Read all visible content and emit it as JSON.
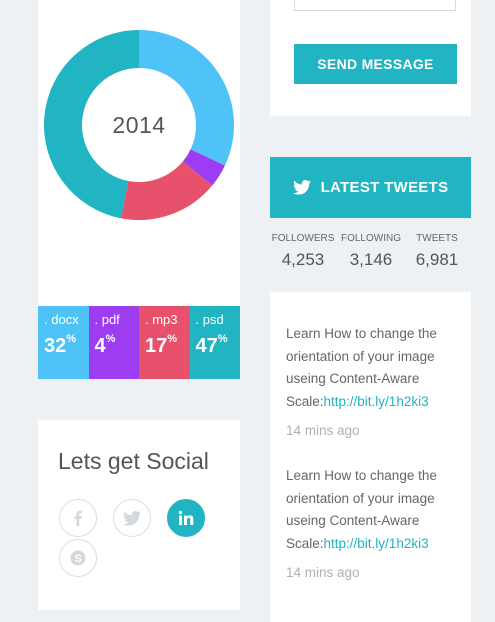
{
  "donut": {
    "center_label": "2014",
    "segments": [
      {
        "name": ".psd",
        "value": 47,
        "color": "#21b4c3"
      },
      {
        "name": ".mp3",
        "value": 17,
        "color": "#e8516b"
      },
      {
        "name": ".pdf",
        "value": 4,
        "color": "#9d3cf0"
      },
      {
        "name": ".docx",
        "value": 32,
        "color": "#4fc3f7"
      }
    ]
  },
  "stats": [
    {
      "ext": ". docx",
      "value": "32",
      "unit": "%",
      "color": "#4fc3f7"
    },
    {
      "ext": ". pdf",
      "value": "4",
      "unit": "%",
      "color": "#9d3cf0"
    },
    {
      "ext": ". mp3",
      "value": "17",
      "unit": "%",
      "color": "#e8516b"
    },
    {
      "ext": ". psd",
      "value": "47",
      "unit": "%",
      "color": "#21b4c3"
    }
  ],
  "social": {
    "title": "Lets get Social",
    "buttons": [
      {
        "icon": "facebook-icon",
        "active": false
      },
      {
        "icon": "twitter-icon",
        "active": false
      },
      {
        "icon": "linkedin-icon",
        "active": true
      },
      {
        "icon": "skype-icon",
        "active": false
      }
    ]
  },
  "form": {
    "send_label": "SEND MESSAGE"
  },
  "tweets": {
    "header": "LATEST TWEETS",
    "followers_label": "FOLLOWERS",
    "followers": "4,253",
    "following_label": "FOLLOWING",
    "following": "3,146",
    "tweets_label": "TWEETS",
    "tweets_count": "6,981",
    "items": [
      {
        "text": "Learn How to change the orientation of your image useing Content-Aware Scale:",
        "link": "http://bit.ly/1h2ki3",
        "ago": "14 mins ago"
      },
      {
        "text": "Learn How to change the orientation of your image useing Content-Aware Scale:",
        "link": "http://bit.ly/1h2ki3",
        "ago": "14 mins ago"
      }
    ]
  },
  "colors": {
    "accent": "#21b4c3",
    "background": "#edf1f4"
  }
}
